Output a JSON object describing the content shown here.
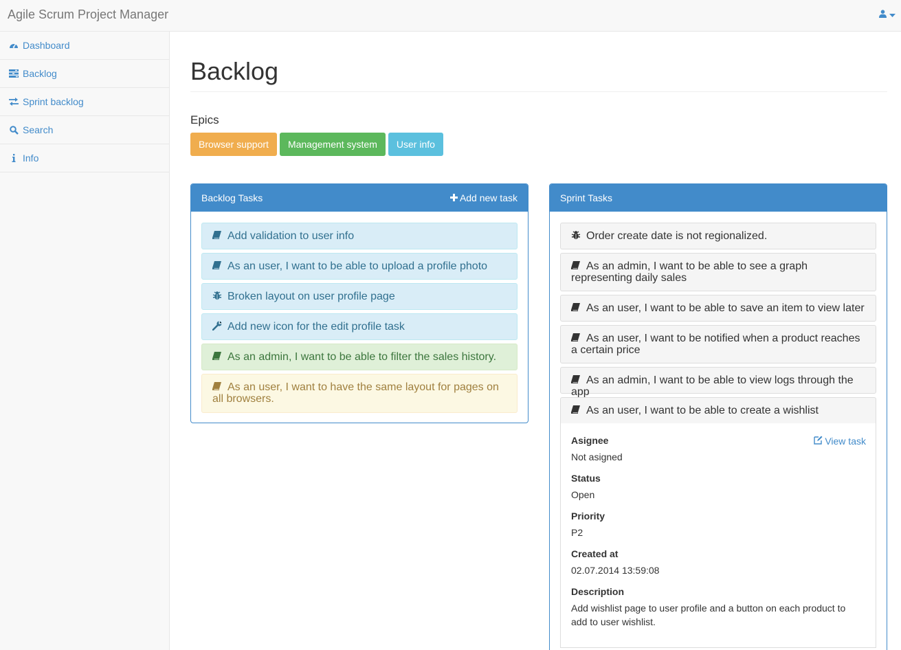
{
  "app": {
    "title": "Agile Scrum Project Manager"
  },
  "sidebar": {
    "items": [
      {
        "label": "Dashboard",
        "icon": "dashboard-icon"
      },
      {
        "label": "Backlog",
        "icon": "tasks-icon"
      },
      {
        "label": "Sprint backlog",
        "icon": "transfer-icon"
      },
      {
        "label": "Search",
        "icon": "search-icon"
      },
      {
        "label": "Info",
        "icon": "info-icon"
      }
    ]
  },
  "page": {
    "title": "Backlog"
  },
  "epics": {
    "label": "Epics",
    "items": [
      {
        "label": "Browser support",
        "color": "#f0ad4e"
      },
      {
        "label": "Management system",
        "color": "#5cb85c"
      },
      {
        "label": "User info",
        "color": "#5bc0de"
      }
    ]
  },
  "backlog": {
    "title": "Backlog Tasks",
    "add_label": "Add new task",
    "items": [
      {
        "text": "Add validation to user info",
        "icon": "book-icon",
        "style": "info"
      },
      {
        "text": "As an user, I want to be able to upload a profile photo",
        "icon": "book-icon",
        "style": "info"
      },
      {
        "text": "Broken layout on user profile page",
        "icon": "bug-icon",
        "style": "info"
      },
      {
        "text": "Add new icon for the edit profile task",
        "icon": "wrench-icon",
        "style": "info"
      },
      {
        "text": "As an admin, I want to be able to filter the sales history.",
        "icon": "book-icon",
        "style": "success"
      },
      {
        "text": "As an user, I want to have the same layout for pages on all browsers.",
        "icon": "book-icon",
        "style": "warning"
      }
    ]
  },
  "sprint": {
    "title": "Sprint Tasks",
    "items": [
      {
        "text": "Order create date is not regionalized.",
        "icon": "bug-icon"
      },
      {
        "text": "As an admin, I want to be able to see a graph representing daily sales",
        "icon": "book-icon"
      },
      {
        "text": "As an user, I want to be able to save an item to view later",
        "icon": "book-icon"
      },
      {
        "text": "As an user, I want to be notified when a product reaches a certain price",
        "icon": "book-icon"
      },
      {
        "text": "As an admin, I want to be able to view logs through the app",
        "icon": "book-icon"
      },
      {
        "text": "As an user, I want to be able to create a wishlist",
        "icon": "book-icon"
      }
    ],
    "detail": {
      "view_label": "View task",
      "assignee_label": "Asignee",
      "assignee": "Not asigned",
      "status_label": "Status",
      "status": "Open",
      "priority_label": "Priority",
      "priority": "P2",
      "created_label": "Created at",
      "created": "02.07.2014 13:59:08",
      "description_label": "Description",
      "description": "Add wishlist page to user profile and a button on each product to add to user wishlist."
    }
  }
}
